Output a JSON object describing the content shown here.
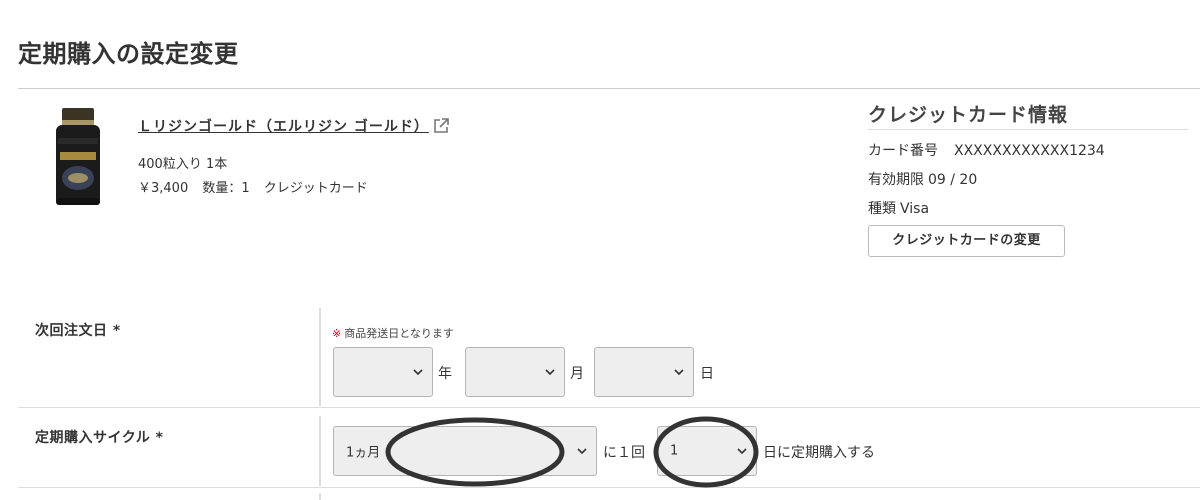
{
  "page_title": "定期購入の設定変更",
  "product": {
    "name": "Ｌリジンゴールド（エルリジン ゴールド）",
    "spec": "400粒入り 1本",
    "price": "￥3,400",
    "quantity": "数量：1",
    "payment": "クレジットカード",
    "image_icon": "supplement-bottle",
    "link_icon": "external-link-icon"
  },
  "credit_card": {
    "title": "クレジットカード情報",
    "number_label": "カード番号",
    "number_value": "XXXXXXXXXXXX1234",
    "expiry_label": "有効期限",
    "expiry_value": "09 / 20",
    "type_label": "種類",
    "type_value": "Visa",
    "change_button": "クレジットカードの変更"
  },
  "next_order": {
    "label": "次回注文日 *",
    "note_mark": "※",
    "note": "商品発送日となります",
    "year_value": "",
    "year_unit": "年",
    "month_value": "",
    "month_unit": "月",
    "day_value": "",
    "day_unit": "日"
  },
  "cycle": {
    "label": "定期購入サイクル *",
    "period_value": "1ヵ月",
    "times_text": "に１回",
    "day_value": "1",
    "suffix": "日に定期購入する"
  },
  "colors": {
    "required_mark": "#d0021b",
    "select_bg": "#eeeeee",
    "annotation": "#333333"
  }
}
